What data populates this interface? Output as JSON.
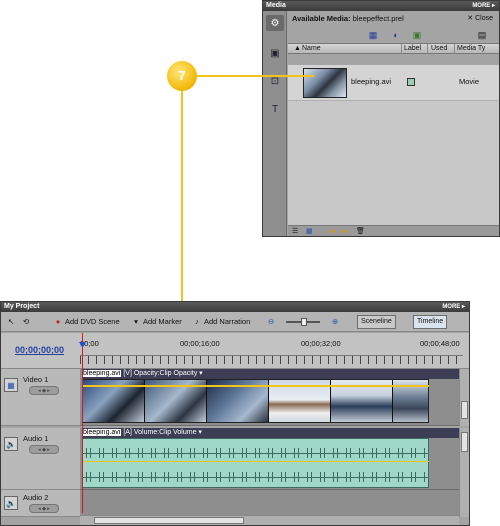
{
  "media_panel": {
    "title": "Media",
    "more": "MORE ▸",
    "available_label": "Available Media:",
    "project_file": "bleepeffect.prel",
    "close": "Close",
    "columns": [
      "Name",
      "Label",
      "Used",
      "Media Ty"
    ],
    "items": [
      {
        "name": "bleeping.avi",
        "label_color": "#9ccfb8",
        "media_type": "Movie"
      }
    ]
  },
  "callout": {
    "number": "7"
  },
  "project_panel": {
    "title": "My Project",
    "more": "MORE ▸",
    "toolbar": {
      "add_dvd_scene": "Add DVD Scene",
      "add_marker": "Add Marker",
      "add_narration": "Add Narration",
      "sceneline": "Sceneline",
      "timeline": "Timeline"
    },
    "timecode": "00;00;00;00",
    "ruler_labels": [
      "00;00",
      "00;00;16;00",
      "00;00;32;00",
      "00;00;48;00"
    ],
    "tracks": [
      {
        "name": "Video 1",
        "clip_file": "bleeping.avi",
        "clip_info": "[V]  Opacity:Clip Opacity ▾"
      },
      {
        "name": "Audio 1",
        "clip_file": "bleeping.avi",
        "clip_info": "[A]  Volume:Clip Volume ▾"
      },
      {
        "name": "Audio 2"
      }
    ]
  },
  "colors": {
    "callout": "#f0c419",
    "playhead": "#d31b1b",
    "audio_clip": "#9fd8c6",
    "timecode": "#2340a0"
  },
  "icons": [
    "media-icon",
    "camera-icon",
    "effects-icon",
    "titles-icon",
    "speaker-icon",
    "selection-tool-icon",
    "zoom-out-icon",
    "zoom-in-icon"
  ]
}
